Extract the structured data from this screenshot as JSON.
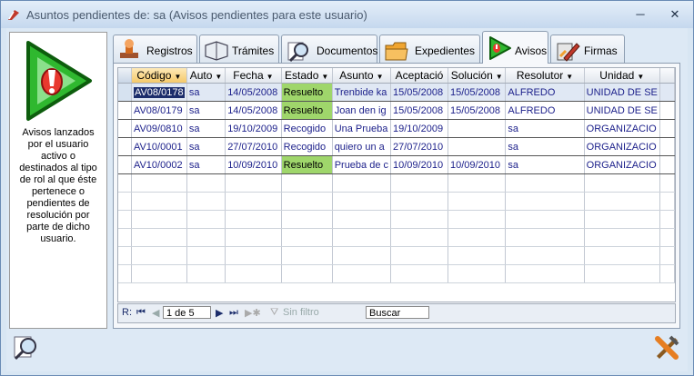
{
  "window": {
    "title": "Asuntos pendientes de: sa (Avisos pendientes para este usuario)",
    "minimize": "─",
    "close": "✕"
  },
  "left_panel": {
    "description": "Avisos lanzados por el usuario activo o destinados al tipo de rol al que éste pertenece o pendientes de resolución por parte de dicho usuario.",
    "icon": "warning-play-icon"
  },
  "tabs": [
    {
      "label": "Registros",
      "icon": "stamp-icon",
      "active": false
    },
    {
      "label": "Trámites",
      "icon": "books-icon",
      "active": false
    },
    {
      "label": "Documentos",
      "icon": "magnifier-icon",
      "active": false
    },
    {
      "label": "Expedientes",
      "icon": "folder-icon",
      "active": false
    },
    {
      "label": "Avisos",
      "icon": "warning-icon",
      "active": true
    },
    {
      "label": "Firmas",
      "icon": "pen-icon",
      "active": false
    }
  ],
  "grid": {
    "columns": [
      "Código",
      "Auto",
      "Fecha",
      "Estado",
      "Asunto",
      "Aceptació",
      "Solución",
      "Resolutor",
      "Unidad"
    ],
    "rows": [
      {
        "codigo": "AV08/0178",
        "auto": "sa",
        "fecha": "14/05/2008",
        "estado": "Resuelto",
        "asunto": "Trenbide ka",
        "aceptacion": "15/05/2008",
        "solucion": "15/05/2008",
        "resolutor": "ALFREDO",
        "unidad": "UNIDAD DE SE"
      },
      {
        "codigo": "AV08/0179",
        "auto": "sa",
        "fecha": "14/05/2008",
        "estado": "Resuelto",
        "asunto": "Joan den ig",
        "aceptacion": "15/05/2008",
        "solucion": "15/05/2008",
        "resolutor": "ALFREDO",
        "unidad": "UNIDAD DE SE"
      },
      {
        "codigo": "AV09/0810",
        "auto": "sa",
        "fecha": "19/10/2009",
        "estado": "Recogido",
        "asunto": "Una Prueba",
        "aceptacion": "19/10/2009",
        "solucion": "",
        "resolutor": "sa",
        "unidad": "ORGANIZACIO"
      },
      {
        "codigo": "AV10/0001",
        "auto": "sa",
        "fecha": "27/07/2010",
        "estado": "Recogido",
        "asunto": "quiero un a",
        "aceptacion": "27/07/2010",
        "solucion": "",
        "resolutor": "sa",
        "unidad": "ORGANIZACIO"
      },
      {
        "codigo": "AV10/0002",
        "auto": "sa",
        "fecha": "10/09/2010",
        "estado": "Resuelto",
        "asunto": "Prueba de c",
        "aceptacion": "10/09/2010",
        "solucion": "10/09/2010",
        "resolutor": "sa",
        "unidad": "ORGANIZACIO"
      }
    ]
  },
  "navigator": {
    "record_label": "R:",
    "position": "1 de 5",
    "filter_label": "Sin filtro",
    "search_placeholder": "Buscar"
  },
  "colors": {
    "resuelto_bg": "#9fd66b",
    "cell_text": "#1b1f8a",
    "window_bg": "#dde9f5"
  }
}
